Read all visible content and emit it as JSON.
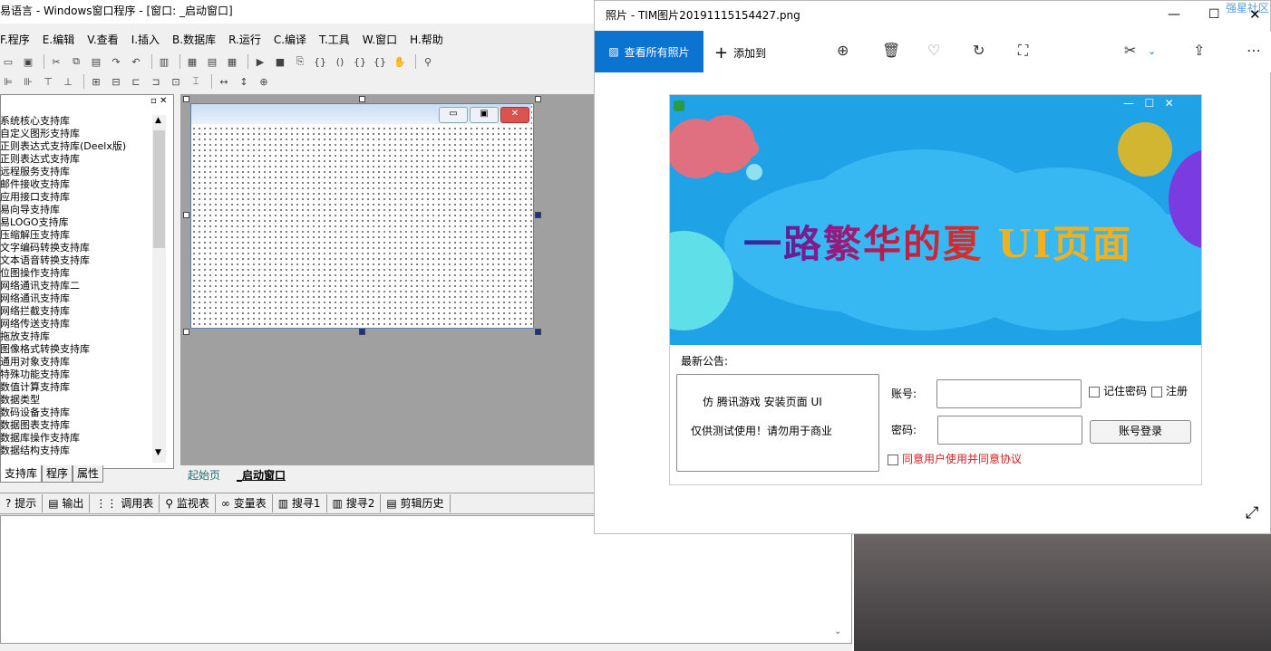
{
  "ide": {
    "title": "易语言 - Windows窗口程序 - [窗口: _启动窗口]",
    "menu": [
      "F.程序",
      "E.编辑",
      "V.查看",
      "I.插入",
      "B.数据库",
      "R.运行",
      "C.编译",
      "T.工具",
      "W.窗口",
      "H.帮助"
    ],
    "libraries": [
      "系统核心支持库",
      "自定义图形支持库",
      "正则表达式支持库(Deelx版)",
      "正则表达式支持库",
      "远程服务支持库",
      "邮件接收支持库",
      "应用接口支持库",
      "易向导支持库",
      "易LOGO支持库",
      "压缩解压支持库",
      "文字编码转换支持库",
      "文本语音转换支持库",
      "位图操作支持库",
      "网络通讯支持库二",
      "网络通讯支持库",
      "网络拦截支持库",
      "网络传送支持库",
      "拖放支持库",
      "图像格式转换支持库",
      "通用对象支持库",
      "特殊功能支持库",
      "数值计算支持库",
      "数据类型",
      "数码设备支持库",
      "数据图表支持库",
      "数据库操作支持库",
      "数据结构支持库"
    ],
    "panel_tabs": [
      "支持库",
      "程序",
      "属性"
    ],
    "doc_tabs": [
      "起始页",
      "_启动窗口"
    ],
    "bottom_tabs": [
      "提示",
      "输出",
      "调用表",
      "监视表",
      "变量表",
      "搜寻1",
      "搜寻2",
      "剪辑历史"
    ]
  },
  "photos": {
    "title": "照片 - TIM图片20191115154427.png",
    "view_all_label": "查看所有照片",
    "add_to_label": "添加到",
    "corner_text": "强星社区"
  },
  "image": {
    "banner_text_part1": "一路繁华的夏",
    "banner_text_part2": "UI页面",
    "notice_label": "最新公告:",
    "notice_line1": "仿 腾讯游戏 安装页面 UI",
    "notice_line2": "仅供测试使用！请勿用于商业",
    "account_label": "账号:",
    "password_label": "密码:",
    "remember_label": "记住密码",
    "register_label": "注册",
    "login_label": "账号登录",
    "agree_label": "同意用户使用并同意协议"
  },
  "colors": {
    "accent": "#0a74d0",
    "banner": "#1fa2e6",
    "agree": "#d02020"
  }
}
